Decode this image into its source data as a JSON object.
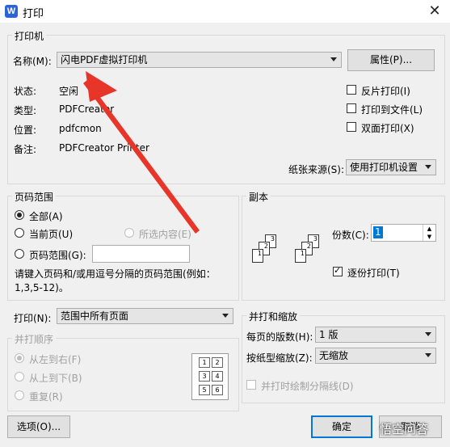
{
  "window": {
    "title": "打印",
    "app_icon_letter": "W"
  },
  "printer": {
    "legend": "打印机",
    "name_label": "名称(M):",
    "name_value": "闪电PDF虚拟打印机",
    "properties_button": "属性(P)...",
    "status_label": "状态:",
    "status_value": "空闲",
    "type_label": "类型:",
    "type_value": "PDFCreator",
    "location_label": "位置:",
    "location_value": "pdfcmon",
    "comment_label": "备注:",
    "comment_value": "PDFCreator Printer",
    "reverse_print": {
      "label": "反片打印(I)",
      "checked": false
    },
    "print_to_file": {
      "label": "打印到文件(L)",
      "checked": false
    },
    "duplex": {
      "label": "双面打印(X)",
      "checked": false
    },
    "paper_source_label": "纸张来源(S):",
    "paper_source_value": "使用打印机设置"
  },
  "page_range": {
    "legend": "页码范围",
    "all": "全部(A)",
    "current": "当前页(U)",
    "selection": "所选内容(E)",
    "pages": "页码范围(G):",
    "pages_value": "",
    "hint": "请键入页码和/或用逗号分隔的页码范围(例如：1,3,5-12)。",
    "selected": "all"
  },
  "copies": {
    "legend": "副本",
    "count_label": "份数(C):",
    "count_value": "1",
    "collate": {
      "label": "逐份打印(T)",
      "checked": true
    },
    "page_numbers": [
      "1",
      "2",
      "3"
    ]
  },
  "print_what": {
    "label": "打印(N):",
    "value": "范围中所有页面"
  },
  "merge_order": {
    "legend": "并打顺序",
    "left_to_right": "从左到右(F)",
    "top_to_bottom": "从上到下(B)",
    "repeat": "重复(R)",
    "grid_numbers": [
      "1",
      "2",
      "3",
      "4",
      "5",
      "6"
    ]
  },
  "zoom": {
    "legend": "并打和缩放",
    "pages_per_sheet_label": "每页的版数(H):",
    "pages_per_sheet_value": "1 版",
    "scale_label": "按纸型缩放(Z):",
    "scale_value": "无缩放",
    "draw_separator": {
      "label": "并打时绘制分隔线(D)",
      "checked": false
    }
  },
  "buttons": {
    "options": "选项(O)...",
    "ok": "确定",
    "cancel": "取消"
  },
  "watermark": "悟空问答",
  "colors": {
    "accent": "#2b63d8",
    "annotation_arrow": "#e8352a",
    "ok_border": "#0078d7"
  }
}
